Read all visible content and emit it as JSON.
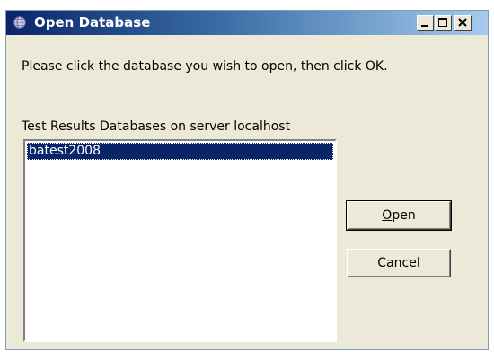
{
  "window": {
    "title": "Open Database",
    "icon": "database-globe-icon"
  },
  "titlebar_buttons": {
    "minimize_icon": "minimize-icon",
    "maximize_icon": "maximize-icon",
    "close_icon": "close-icon"
  },
  "instruction": "Please click the database you wish to open, then click OK.",
  "list": {
    "caption": "Test Results Databases on server localhost",
    "items": [
      "batest2008"
    ],
    "selected_index": 0
  },
  "buttons": {
    "open": {
      "mnemonic": "O",
      "rest": "pen"
    },
    "cancel": {
      "mnemonic": "C",
      "rest": "ancel"
    }
  },
  "colors": {
    "titlebar_start": "#0a246a",
    "titlebar_end": "#a6caf0",
    "selection": "#0a246a",
    "dialog_background": "#ece9d8"
  }
}
